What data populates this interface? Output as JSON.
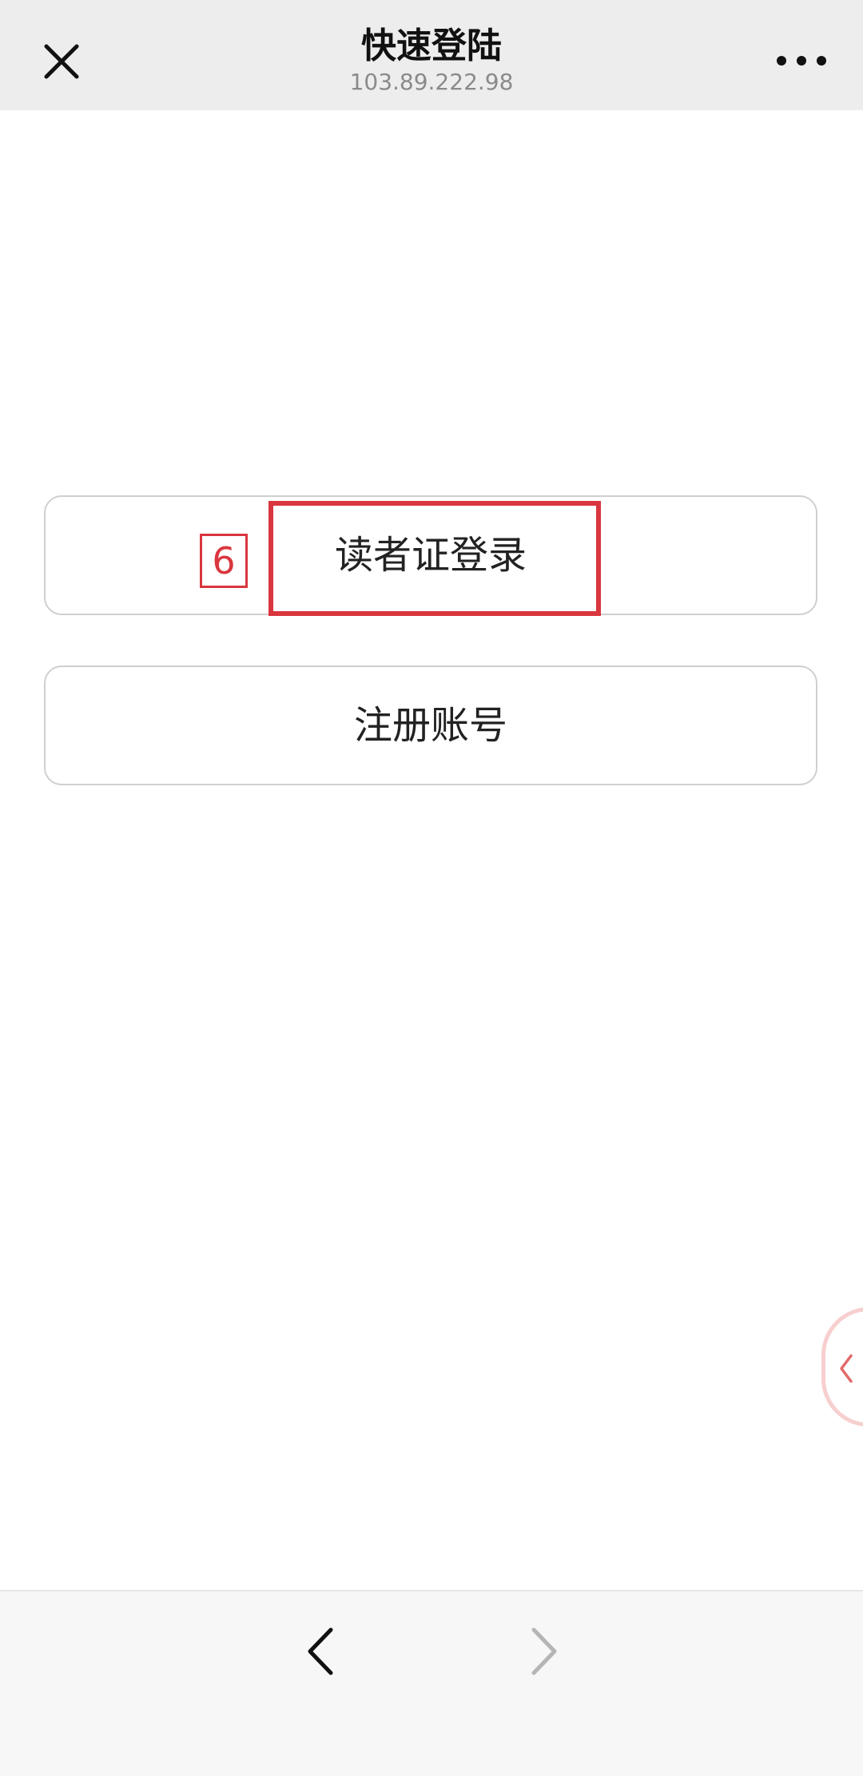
{
  "topbar": {
    "title": "快速登陆",
    "subtitle": "103.89.222.98",
    "close_icon": "close-icon",
    "more_icon": "more-icon"
  },
  "main": {
    "reader_login_label": "读者证登录",
    "register_label": "注册账号",
    "annotation_number": "6"
  },
  "side_handle": {
    "icon": "chevron-left-icon"
  },
  "bottombar": {
    "back_icon": "chevron-left-icon",
    "forward_icon": "chevron-right-icon"
  },
  "colors": {
    "topbar_bg": "#ededed",
    "annotation_red": "#d9363e",
    "button_border": "#cfcfcf",
    "bottombar_bg": "#f7f7f7"
  }
}
